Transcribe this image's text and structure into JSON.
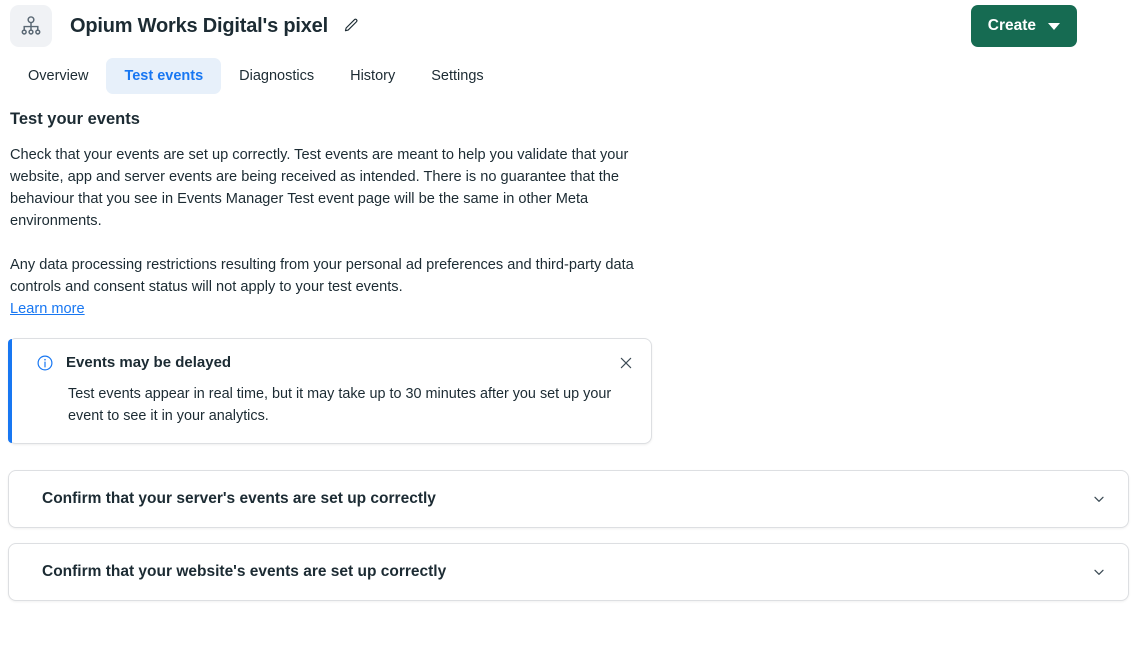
{
  "header": {
    "pixel_icon": "pixel-network-icon",
    "title": "Opium Works Digital's pixel",
    "edit_icon": "edit-pencil-icon",
    "create_label": "Create",
    "create_color": "#166b52",
    "create_caret_icon": "caret-down-icon"
  },
  "tabs": [
    {
      "label": "Overview",
      "active": false
    },
    {
      "label": "Test events",
      "active": true
    },
    {
      "label": "Diagnostics",
      "active": false
    },
    {
      "label": "History",
      "active": false
    },
    {
      "label": "Settings",
      "active": false
    }
  ],
  "tab_active_color": "#1877f2",
  "tab_active_bg": "#e7f0fa",
  "main": {
    "heading": "Test your events",
    "paragraph_1": "Check that your events are set up correctly. Test events are meant to help you validate that your website, app and server events are being received as intended. There is no guarantee that the behaviour that you see in Events Manager Test event page will be the same in other Meta environments.",
    "paragraph_2": "Any data processing restrictions resulting from your personal ad preferences and third-party data controls and consent status will not apply to your test events.",
    "learn_more": "Learn more",
    "link_color": "#1877f2"
  },
  "banner": {
    "info_icon": "info-circle-icon",
    "title": "Events may be delayed",
    "body": "Test events appear in real time, but it may take up to 30 minutes after you set up your event to see it in your analytics.",
    "close_icon": "close-x-icon",
    "accent_color": "#1877f2"
  },
  "accordions": [
    {
      "title": "Confirm that your server's events are set up correctly",
      "chevron_icon": "chevron-down-icon",
      "expanded": false
    },
    {
      "title": "Confirm that your website's events are set up correctly",
      "chevron_icon": "chevron-down-icon",
      "expanded": false
    }
  ]
}
